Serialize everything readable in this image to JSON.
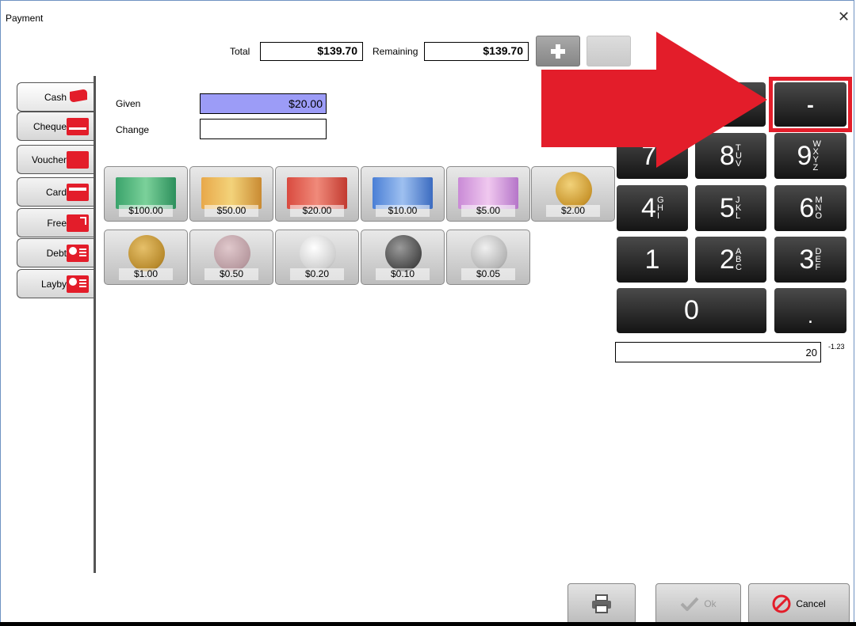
{
  "window": {
    "title": "Payment",
    "close_label": "✕"
  },
  "summary": {
    "total_label": "Total",
    "total_value": "$139.70",
    "remaining_label": "Remaining",
    "remaining_value": "$139.70",
    "plus_label": "+",
    "minus_label": "-"
  },
  "tabs": [
    {
      "label": "Cash",
      "icon": "cash-flag-icon"
    },
    {
      "label": "Cheque",
      "icon": "cheque-icon"
    },
    {
      "label": "Voucher",
      "icon": "voucher-icon"
    },
    {
      "label": "Card",
      "icon": "card-icon"
    },
    {
      "label": "Free",
      "icon": "free-icon"
    },
    {
      "label": "Debt",
      "icon": "debt-person-icon"
    },
    {
      "label": "Layby",
      "icon": "layby-person-icon"
    }
  ],
  "cash": {
    "given_label": "Given",
    "given_value": "$20.00",
    "change_label": "Change",
    "change_value": ""
  },
  "denominations": {
    "row1": [
      "$100.00",
      "$50.00",
      "$20.00",
      "$10.00",
      "$5.00",
      "$2.00"
    ],
    "row2": [
      "$1.00",
      "$0.50",
      "$0.20",
      "$0.10",
      "$0.05"
    ]
  },
  "keypad": {
    "minus": "-",
    "k7": "7",
    "k7_sub": "P",
    "k8": "8",
    "k8_sub": "TUV",
    "k9": "9",
    "k9_sub": "WXYZ",
    "k4": "4",
    "k4_sub": "GHI",
    "k5": "5",
    "k5_sub": "JKL",
    "k6": "6",
    "k6_sub": "MNO",
    "k1": "1",
    "k2": "2",
    "k2_sub": "ABC",
    "k3": "3",
    "k3_sub": "DEF",
    "k0": "0",
    "dot": ".",
    "display_value": "20",
    "display_sup": "-1.23"
  },
  "footer": {
    "print_icon": "printer-icon",
    "ok_label": "Ok",
    "cancel_label": "Cancel"
  },
  "colors": {
    "accent_red": "#e31d2a",
    "given_bg": "#9c9cf7",
    "key_bg": "#1e1e1e"
  }
}
